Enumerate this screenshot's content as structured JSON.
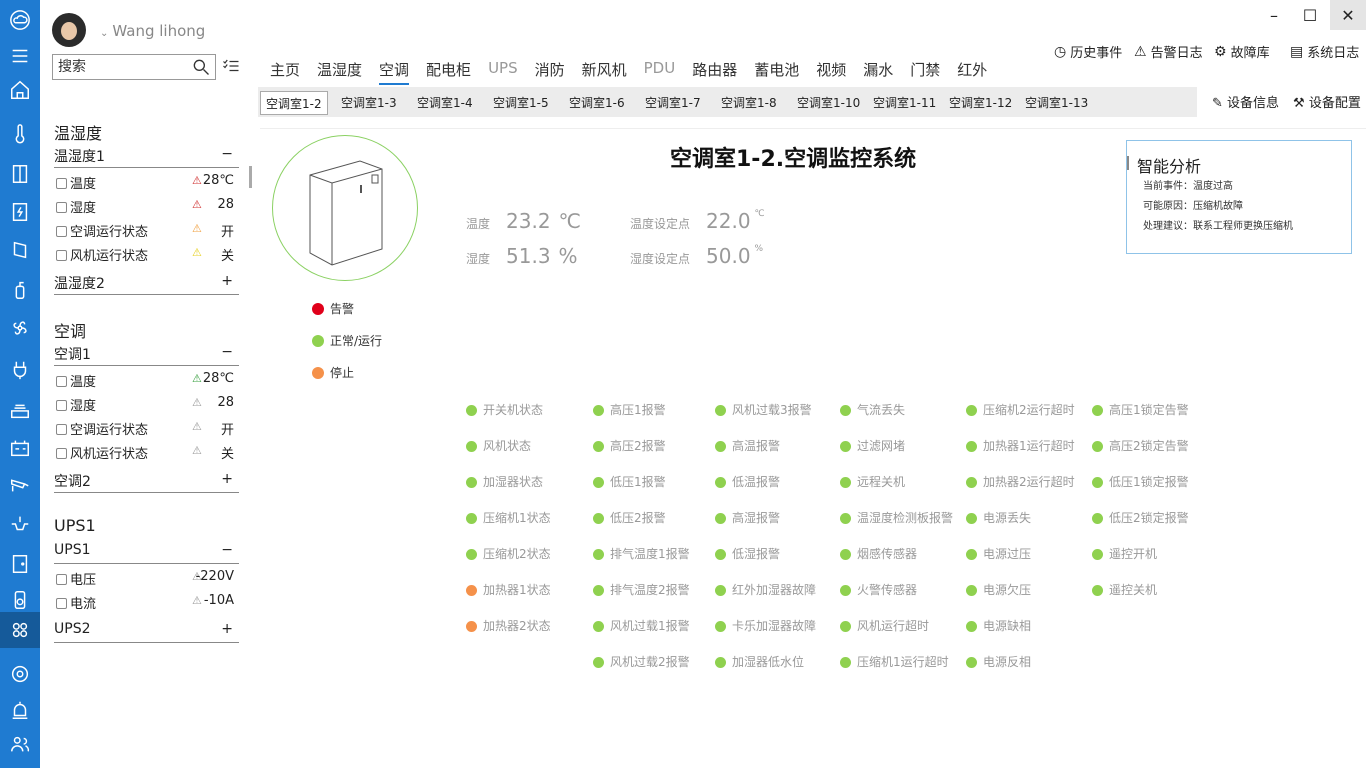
{
  "user": {
    "name": "Wang lihong"
  },
  "search": {
    "placeholder": "搜索"
  },
  "sidebar": {
    "groups": [
      {
        "title": "温湿度",
        "subs": [
          {
            "label": "温湿度1",
            "toggle": "−",
            "rows": [
              {
                "label": "温度",
                "value": "28℃",
                "bell_color": "#d03030"
              },
              {
                "label": "湿度",
                "value": "28",
                "bell_color": "#d03030"
              },
              {
                "label": "空调运行状态",
                "value": "开",
                "bell_color": "#f0a040"
              },
              {
                "label": "风机运行状态",
                "value": "关",
                "bell_color": "#e6d020"
              }
            ]
          },
          {
            "label": "温湿度2",
            "toggle": "+"
          }
        ]
      },
      {
        "title": "空调",
        "subs": [
          {
            "label": "空调1",
            "toggle": "−",
            "rows": [
              {
                "label": "温度",
                "value": "28℃",
                "bell_color": "#3aa040"
              },
              {
                "label": "湿度",
                "value": "28",
                "bell_color": "#999999"
              },
              {
                "label": "空调运行状态",
                "value": "开",
                "bell_color": "#999999"
              },
              {
                "label": "风机运行状态",
                "value": "关",
                "bell_color": "#999999"
              }
            ]
          },
          {
            "label": "空调2",
            "toggle": "+"
          }
        ]
      },
      {
        "title": "UPS1",
        "subs": [
          {
            "label": "UPS1",
            "toggle": "−",
            "rows": [
              {
                "label": "电压",
                "value": "-220V",
                "bell_color": "#999999"
              },
              {
                "label": "电流",
                "value": "-10A",
                "bell_color": "#999999"
              }
            ]
          },
          {
            "label": "UPS2",
            "toggle": "+"
          }
        ]
      }
    ]
  },
  "top_links": [
    "历史事件",
    "告警日志",
    "故障库",
    "系统日志"
  ],
  "tabs": [
    "主页",
    "温湿度",
    "空调",
    "配电柜",
    "UPS",
    "消防",
    "新风机",
    "PDU",
    "路由器",
    "蓄电池",
    "视频",
    "漏水",
    "门禁",
    "红外"
  ],
  "active_tab": "空调",
  "rooms": [
    "空调室1-2",
    "空调室1-3",
    "空调室1-4",
    "空调室1-5",
    "空调室1-6",
    "空调室1-7",
    "空调室1-8",
    "空调室1-10",
    "空调室1-11",
    "空调室1-12",
    "空调室1-13"
  ],
  "active_room": "空调室1-2",
  "device_links": [
    "设备信息",
    "设备配置"
  ],
  "panel": {
    "title": "空调室1-2.空调监控系统",
    "metrics": [
      {
        "label": "温度",
        "value": "23.2",
        "unit": "℃"
      },
      {
        "label": "温度设定点",
        "value": "22.0",
        "unit": "℃"
      },
      {
        "label": "湿度",
        "value": "51.3",
        "unit": "%"
      },
      {
        "label": "湿度设定点",
        "value": "50.0",
        "unit": "%"
      }
    ],
    "legend": [
      {
        "label": "告警",
        "color": "#e0001a"
      },
      {
        "label": "正常/运行",
        "color": "#8fd14f"
      },
      {
        "label": "停止",
        "color": "#f5914a"
      }
    ],
    "analysis": {
      "title": "智能分析",
      "lines": [
        "当前事件：温度过高",
        "可能原因：压缩机故障",
        "处理建议：联系工程师更换压缩机"
      ]
    },
    "status_columns": [
      [
        {
          "label": "开关机状态",
          "color": "#8fd14f"
        },
        {
          "label": "风机状态",
          "color": "#8fd14f"
        },
        {
          "label": "加湿器状态",
          "color": "#8fd14f"
        },
        {
          "label": "压缩机1状态",
          "color": "#8fd14f"
        },
        {
          "label": "压缩机2状态",
          "color": "#8fd14f"
        },
        {
          "label": "加热器1状态",
          "color": "#f5914a"
        },
        {
          "label": "加热器2状态",
          "color": "#f5914a"
        }
      ],
      [
        {
          "label": "高压1报警",
          "color": "#8fd14f"
        },
        {
          "label": "高压2报警",
          "color": "#8fd14f"
        },
        {
          "label": "低压1报警",
          "color": "#8fd14f"
        },
        {
          "label": "低压2报警",
          "color": "#8fd14f"
        },
        {
          "label": "排气温度1报警",
          "color": "#8fd14f"
        },
        {
          "label": "排气温度2报警",
          "color": "#8fd14f"
        },
        {
          "label": "风机过载1报警",
          "color": "#8fd14f"
        },
        {
          "label": "风机过载2报警",
          "color": "#8fd14f"
        }
      ],
      [
        {
          "label": "风机过载3报警",
          "color": "#8fd14f"
        },
        {
          "label": "高温报警",
          "color": "#8fd14f"
        },
        {
          "label": "低温报警",
          "color": "#8fd14f"
        },
        {
          "label": "高湿报警",
          "color": "#8fd14f"
        },
        {
          "label": "低湿报警",
          "color": "#8fd14f"
        },
        {
          "label": "红外加湿器故障",
          "color": "#8fd14f"
        },
        {
          "label": "卡乐加湿器故障",
          "color": "#8fd14f"
        },
        {
          "label": "加湿器低水位",
          "color": "#8fd14f"
        }
      ],
      [
        {
          "label": "气流丢失",
          "color": "#8fd14f"
        },
        {
          "label": "过滤网堵",
          "color": "#8fd14f"
        },
        {
          "label": "远程关机",
          "color": "#8fd14f"
        },
        {
          "label": "温湿度检测板报警",
          "color": "#8fd14f"
        },
        {
          "label": "烟感传感器",
          "color": "#8fd14f"
        },
        {
          "label": "火警传感器",
          "color": "#8fd14f"
        },
        {
          "label": "风机运行超时",
          "color": "#8fd14f"
        },
        {
          "label": "压缩机1运行超时",
          "color": "#8fd14f"
        }
      ],
      [
        {
          "label": "压缩机2运行超时",
          "color": "#8fd14f"
        },
        {
          "label": "加热器1运行超时",
          "color": "#8fd14f"
        },
        {
          "label": "加热器2运行超时",
          "color": "#8fd14f"
        },
        {
          "label": "电源丢失",
          "color": "#8fd14f"
        },
        {
          "label": "电源过压",
          "color": "#8fd14f"
        },
        {
          "label": "电源欠压",
          "color": "#8fd14f"
        },
        {
          "label": "电源缺相",
          "color": "#8fd14f"
        },
        {
          "label": "电源反相",
          "color": "#8fd14f"
        }
      ],
      [
        {
          "label": "高压1锁定告警",
          "color": "#8fd14f"
        },
        {
          "label": "高压2锁定告警",
          "color": "#8fd14f"
        },
        {
          "label": "低压1锁定报警",
          "color": "#8fd14f"
        },
        {
          "label": "低压2锁定报警",
          "color": "#8fd14f"
        },
        {
          "label": "遥控开机",
          "color": "#8fd14f"
        },
        {
          "label": "遥控关机",
          "color": "#8fd14f"
        }
      ]
    ]
  }
}
